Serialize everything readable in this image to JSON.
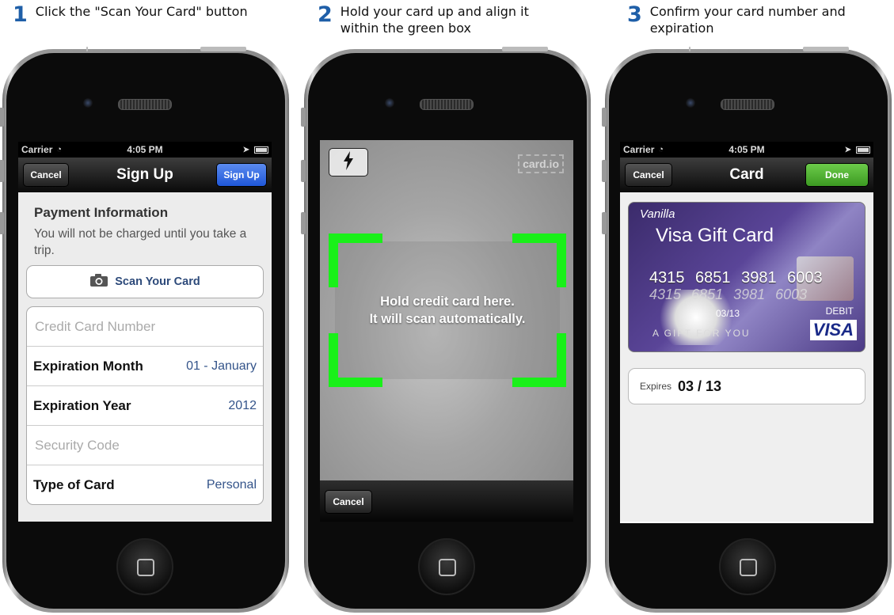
{
  "steps": [
    {
      "number": "1",
      "text": "Click the \"Scan Your Card\" button"
    },
    {
      "number": "2",
      "text": "Hold your card up and align it within the green box"
    },
    {
      "number": "3",
      "text": "Confirm your card number and expiration"
    }
  ],
  "status": {
    "carrier": "Carrier",
    "time": "4:05 PM"
  },
  "phone1": {
    "cancel": "Cancel",
    "title": "Sign Up",
    "signup": "Sign Up",
    "section_title": "Payment Information",
    "section_sub": "You will not be charged until you take a trip.",
    "scan_button": "Scan Your Card",
    "card_number_placeholder": "Credit Card Number",
    "exp_month_label": "Expiration Month",
    "exp_month_value": "01 - January",
    "exp_year_label": "Expiration Year",
    "exp_year_value": "2012",
    "security_placeholder": "Security Code",
    "type_label": "Type of Card",
    "type_value": "Personal"
  },
  "phone2": {
    "logo": "card.io",
    "message_line1": "Hold credit card here.",
    "message_line2": "It will scan automatically.",
    "cancel": "Cancel",
    "accent_color": "#19f019"
  },
  "phone3": {
    "cancel": "Cancel",
    "title": "Card",
    "done": "Done",
    "card_brand": "Vanilla",
    "card_name": "Visa Gift Card",
    "card_number": "4315 6851 3981 6003",
    "card_expiry": "03/13",
    "card_gift_text": "A GIFT FOR YOU",
    "card_debit": "DEBIT",
    "card_network": "VISA",
    "expires_label": "Expires",
    "expires_value": "03 / 13"
  }
}
